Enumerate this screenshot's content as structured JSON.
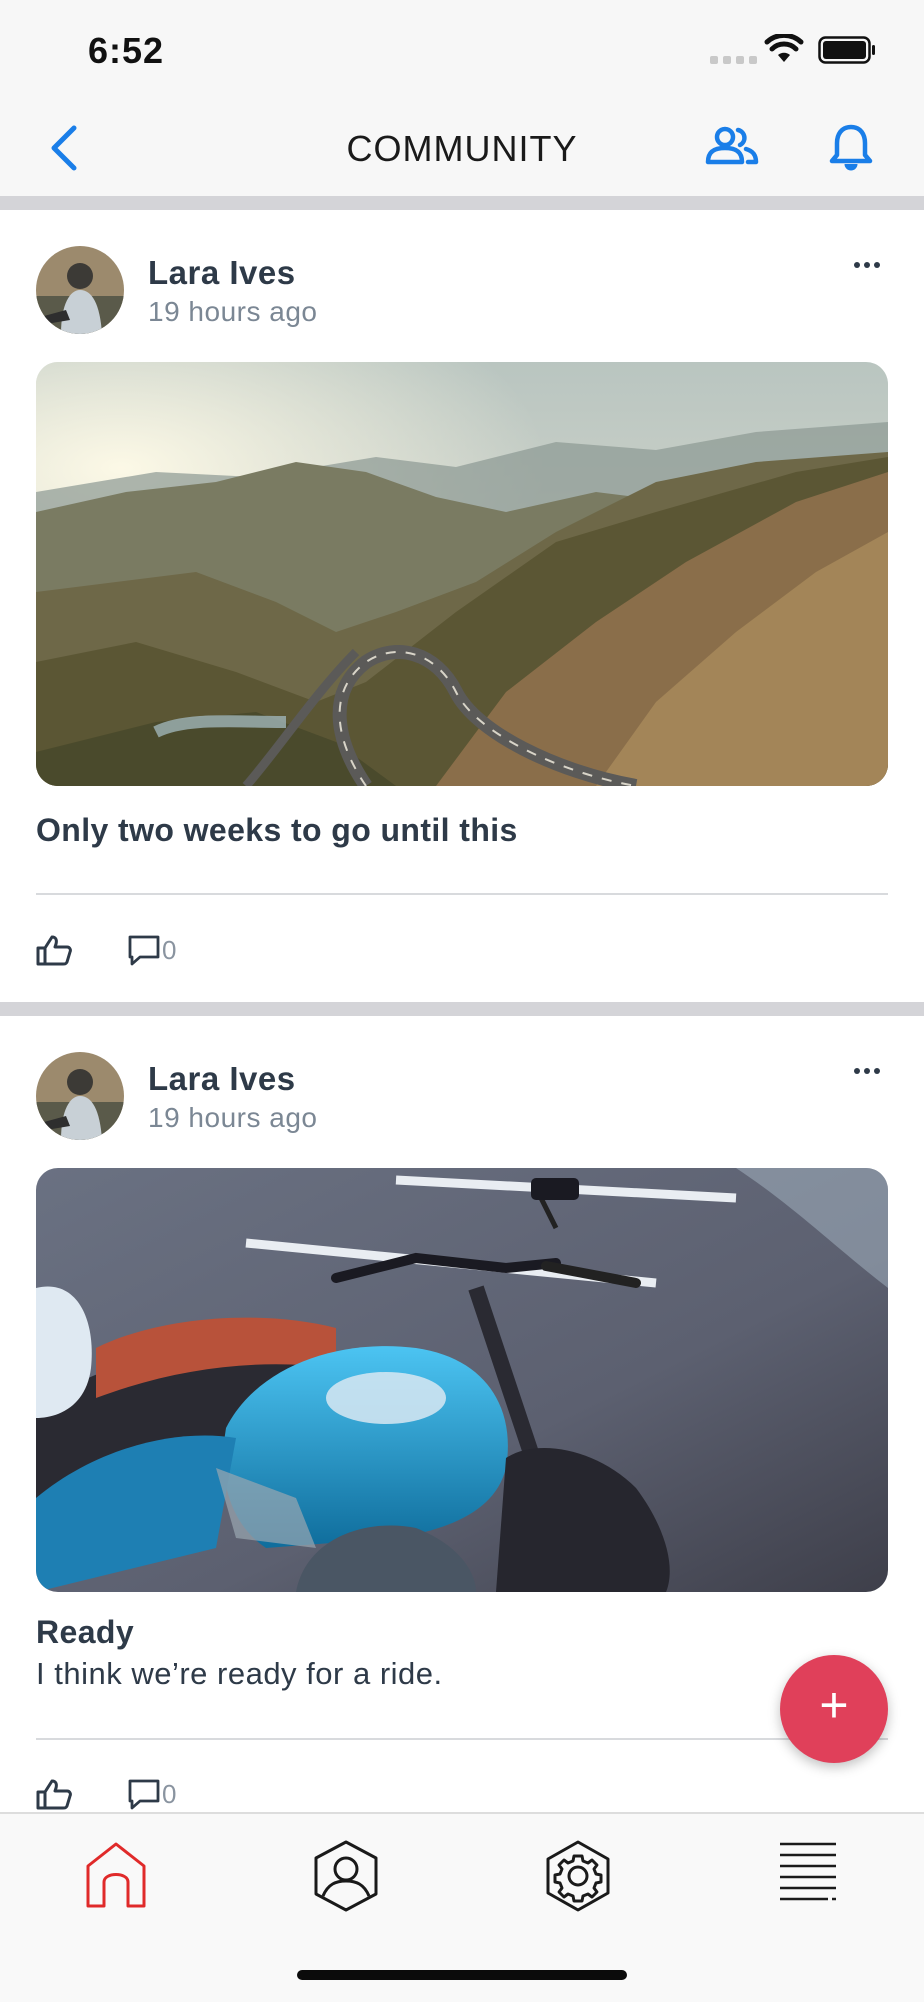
{
  "status_bar": {
    "time": "6:52"
  },
  "header": {
    "title": "COMMUNITY"
  },
  "posts": [
    {
      "author": "Lara Ives",
      "time_ago": "19 hours ago",
      "title": "Only two weeks to go until this",
      "body": "",
      "comment_count": "0"
    },
    {
      "author": "Lara Ives",
      "time_ago": "19 hours ago",
      "title": "Ready",
      "body": "I think we’re ready for a ride.",
      "comment_count": "0"
    }
  ],
  "fab": {
    "label": "+"
  },
  "tabs": [
    {
      "icon": "home-icon",
      "active": true
    },
    {
      "icon": "profile-icon",
      "active": false
    },
    {
      "icon": "settings-icon",
      "active": false
    },
    {
      "icon": "menu-icon",
      "active": false
    }
  ],
  "colors": {
    "accent": "#1a7ee8",
    "fab": "#e0405a",
    "active_tab": "#e02a2a"
  }
}
